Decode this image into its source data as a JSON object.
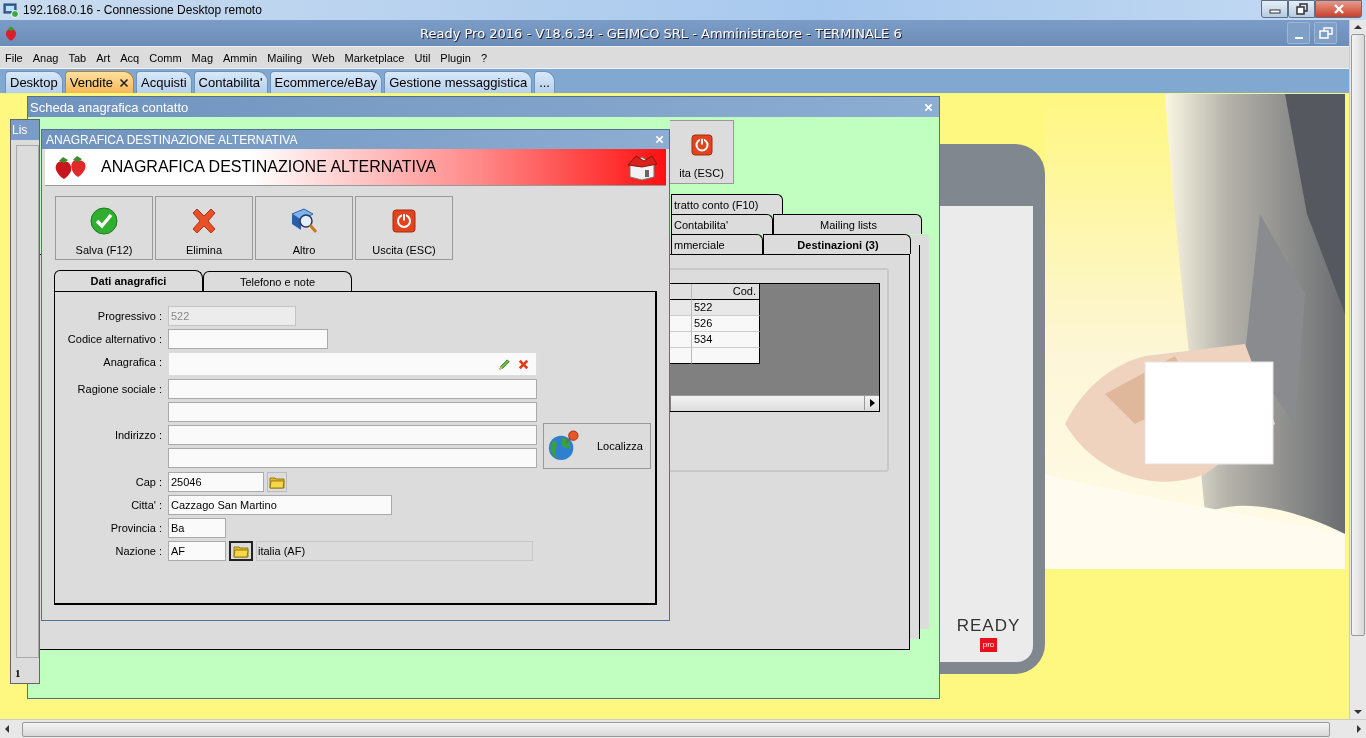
{
  "remote_window": {
    "title": "192.168.0.16 - Connessione Desktop remoto"
  },
  "app": {
    "title": "Ready Pro 2016 - V18.6.34 - GEIMCO SRL - Amministratore - TERMINALE 6"
  },
  "menu": [
    "File",
    "Anag",
    "Tab",
    "Art",
    "Acq",
    "Comm",
    "Mag",
    "Ammin",
    "Mailing",
    "Web",
    "Marketplace",
    "Util",
    "Plugin",
    "?"
  ],
  "tabs": [
    {
      "label": "Desktop",
      "selected": false,
      "closable": false
    },
    {
      "label": "Vendite",
      "selected": true,
      "closable": true
    },
    {
      "label": "Acquisti",
      "selected": false,
      "closable": false
    },
    {
      "label": "Contabilita'",
      "selected": false,
      "closable": false
    },
    {
      "label": "Ecommerce/eBay",
      "selected": false,
      "closable": false
    },
    {
      "label": "Gestione messaggistica",
      "selected": false,
      "closable": false
    },
    {
      "label": "...",
      "selected": false,
      "closable": false
    }
  ],
  "list_window": {
    "title": "Lis",
    "status": "1"
  },
  "splash": {
    "logo": "READY",
    "badge": "pro"
  },
  "contact_window": {
    "title": "Scheda anagrafica contatto",
    "toolbar_button": "ita (ESC)",
    "tab_rows": [
      [
        {
          "label": "tratto conto (F10)",
          "selected": false
        }
      ],
      [
        {
          "label": "Contabilita'",
          "selected": false
        },
        {
          "label": "Mailing lists",
          "selected": false
        }
      ],
      [
        {
          "label": "mmerciale",
          "selected": false
        },
        {
          "label": "Destinazioni (3)",
          "selected": true
        }
      ]
    ],
    "grid": {
      "columns": [
        "Cod."
      ],
      "rows": [
        "522",
        "526",
        "534"
      ]
    }
  },
  "dialog": {
    "title": "ANAGRAFICA DESTINAZIONE ALTERNATIVA",
    "header": "ANAGRAFICA DESTINAZIONE ALTERNATIVA",
    "buttons": [
      {
        "label": "Salva (F12)",
        "kind": "save"
      },
      {
        "label": "Elimina",
        "kind": "delete"
      },
      {
        "label": "Altro",
        "kind": "search"
      },
      {
        "label": "Uscita (ESC)",
        "kind": "exit"
      }
    ],
    "tabs": [
      {
        "label": "Dati anagrafici",
        "selected": true
      },
      {
        "label": "Telefono e note",
        "selected": false
      }
    ],
    "fields": [
      {
        "label": "Progressivo :",
        "kind": "short",
        "value": "522",
        "disabled": true
      },
      {
        "label": "Codice alternativo :",
        "kind": "medium",
        "disabled": false
      },
      {
        "label": "Anagrafica :",
        "kind": "lookup",
        "disabled": false
      },
      {
        "label": "Ragione sociale :",
        "kind": "double",
        "disabled": false
      },
      {
        "label": "Indirizzo :",
        "kind": "address",
        "button": "Localizza",
        "disabled": false
      },
      {
        "label": "Cap :",
        "kind": "picker",
        "value": "25046",
        "disabled": false
      },
      {
        "label": "Citta' :",
        "kind": "city",
        "value": "Cazzago San Martino",
        "disabled": false
      },
      {
        "label": "Provincia :",
        "kind": "tiny",
        "value": "Ba",
        "disabled": false
      },
      {
        "label": "Nazione :",
        "kind": "country",
        "value": "AF",
        "display": "italia (AF)",
        "disabled": false
      }
    ]
  }
}
